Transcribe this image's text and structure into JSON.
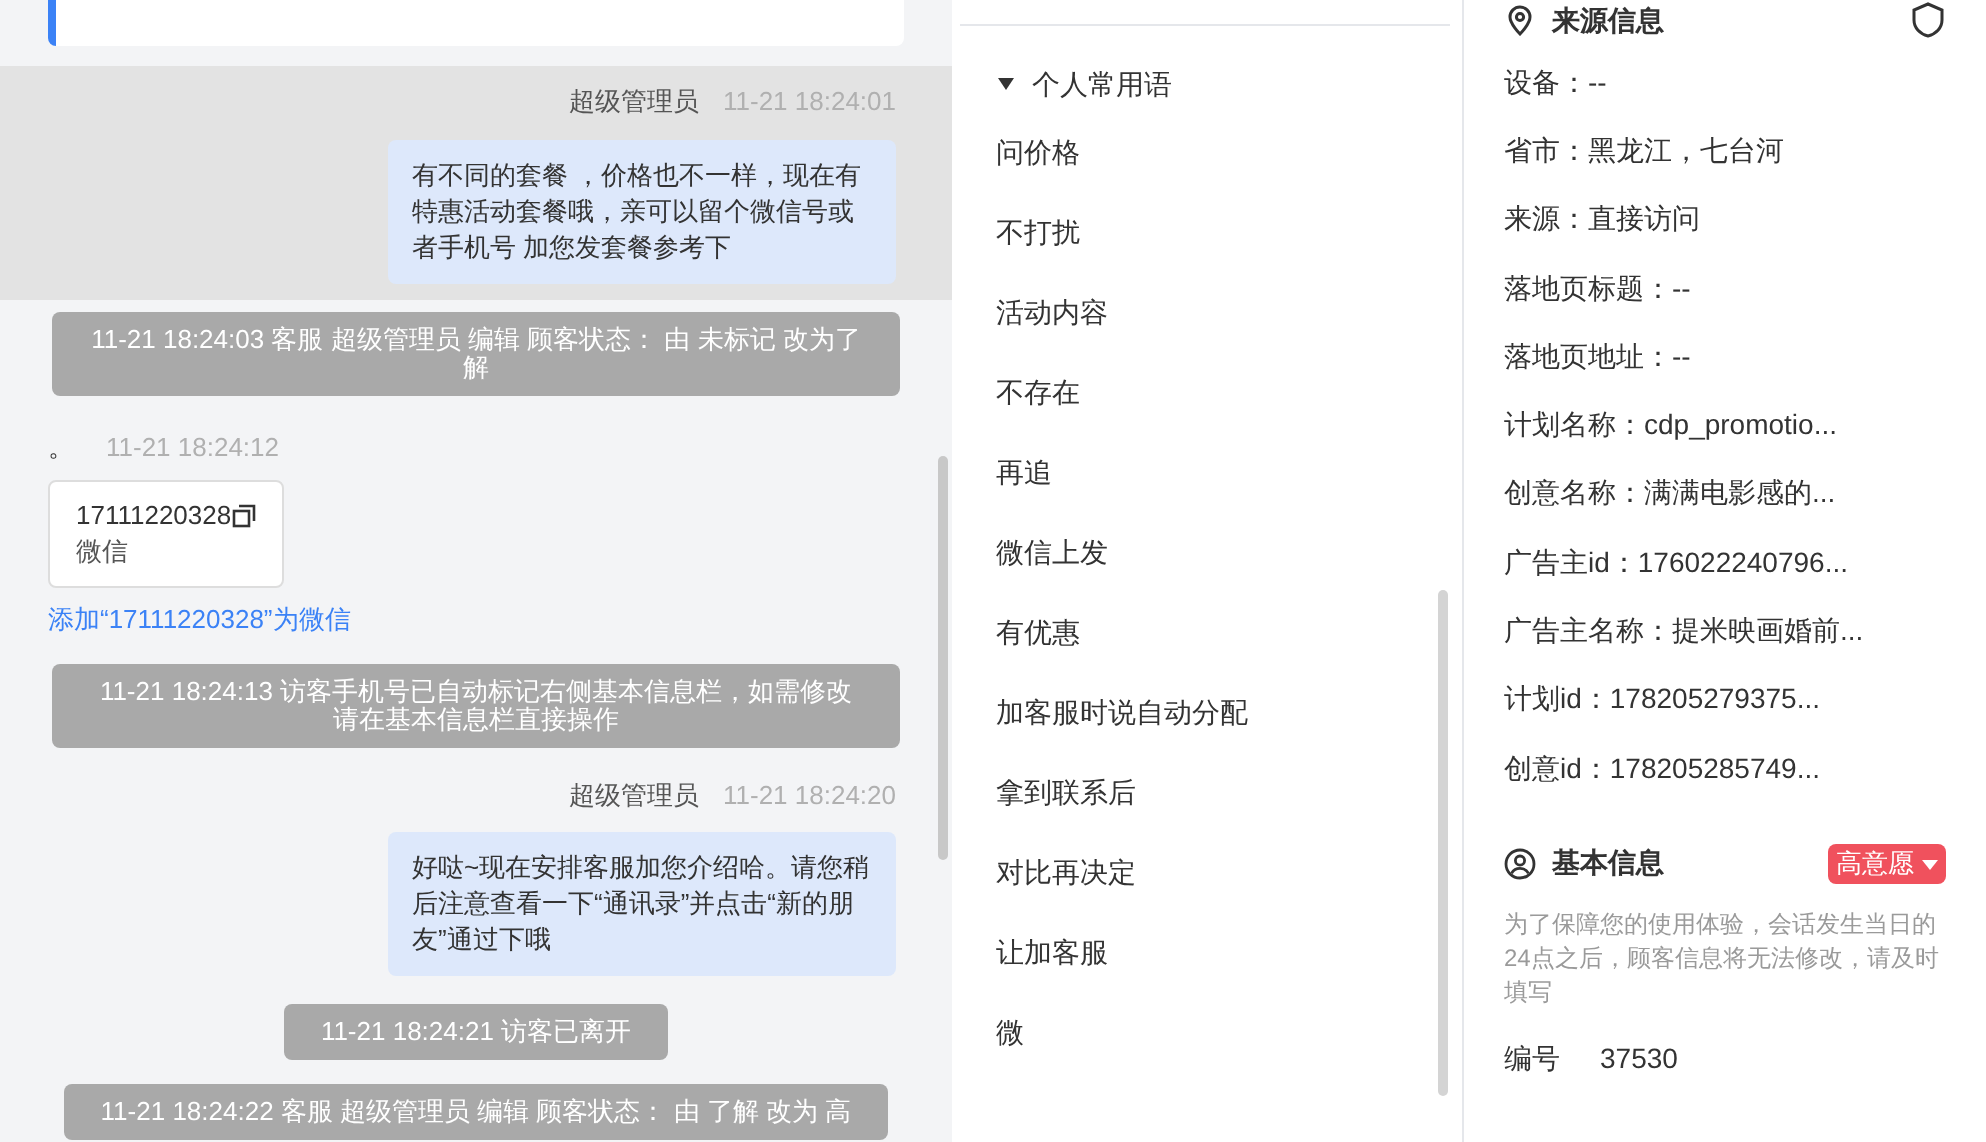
{
  "chat": {
    "messages": [
      {
        "kind": "agent",
        "sender": "超级管理员",
        "time": "11-21 18:24:01",
        "text": "有不同的套餐 ，价格也不一样，现在有特惠活动套餐哦，亲可以留个微信号或者手机号 加您发套餐参考下",
        "highlighted": true
      },
      {
        "kind": "system",
        "text": "11-21 18:24:03 客服 超级管理员 编辑 顾客状态： 由 未标记 改为了解"
      },
      {
        "kind": "visitor",
        "text": "。",
        "time": "11-21 18:24:12",
        "card": {
          "number": "17111220328",
          "label": "微信"
        },
        "link": "添加“17111220328”为微信"
      },
      {
        "kind": "system",
        "text": "11-21 18:24:13 访客手机号已自动标记右侧基本信息栏，如需修改请在基本信息栏直接操作"
      },
      {
        "kind": "agent",
        "sender": "超级管理员",
        "time": "11-21 18:24:20",
        "text": "好哒~现在安排客服加您介绍哈。请您稍后注意查看一下“通讯录”并点击“新的朋友”通过下哦",
        "highlighted": false
      },
      {
        "kind": "system",
        "text": "11-21 18:24:21 访客已离开"
      },
      {
        "kind": "system",
        "text": "11-21 18:24:22 客服 超级管理员 编辑 顾客状态： 由 了解 改为 高"
      }
    ]
  },
  "quick_replies": {
    "title": "个人常用语",
    "expanded": true,
    "items": [
      "问价格",
      "不打扰",
      "活动内容",
      "不存在",
      "再追",
      "微信上发",
      "有优惠",
      "加客服时说自动分配",
      "拿到联系后",
      "对比再决定",
      "让加客服",
      "微"
    ]
  },
  "source_info": {
    "title": "来源信息",
    "fields": [
      "设备：--",
      "省市：黑龙江，七台河",
      "来源：直接访问",
      "落地页标题：--",
      "落地页地址：--",
      "计划名称：cdp_promotio...",
      "创意名称：满满电影感的...",
      "广告主id：176022240796...",
      "广告主名称：提米映画婚前...",
      "计划id：178205279375...",
      "创意id：178205285749..."
    ]
  },
  "basic_info": {
    "title": "基本信息",
    "intent": "高意愿",
    "notice": "为了保障您的使用体验，会话发生当日的24点之后，顾客信息将无法修改，请及时填写",
    "fields": [
      {
        "label": "编号",
        "value": "37530"
      }
    ]
  }
}
